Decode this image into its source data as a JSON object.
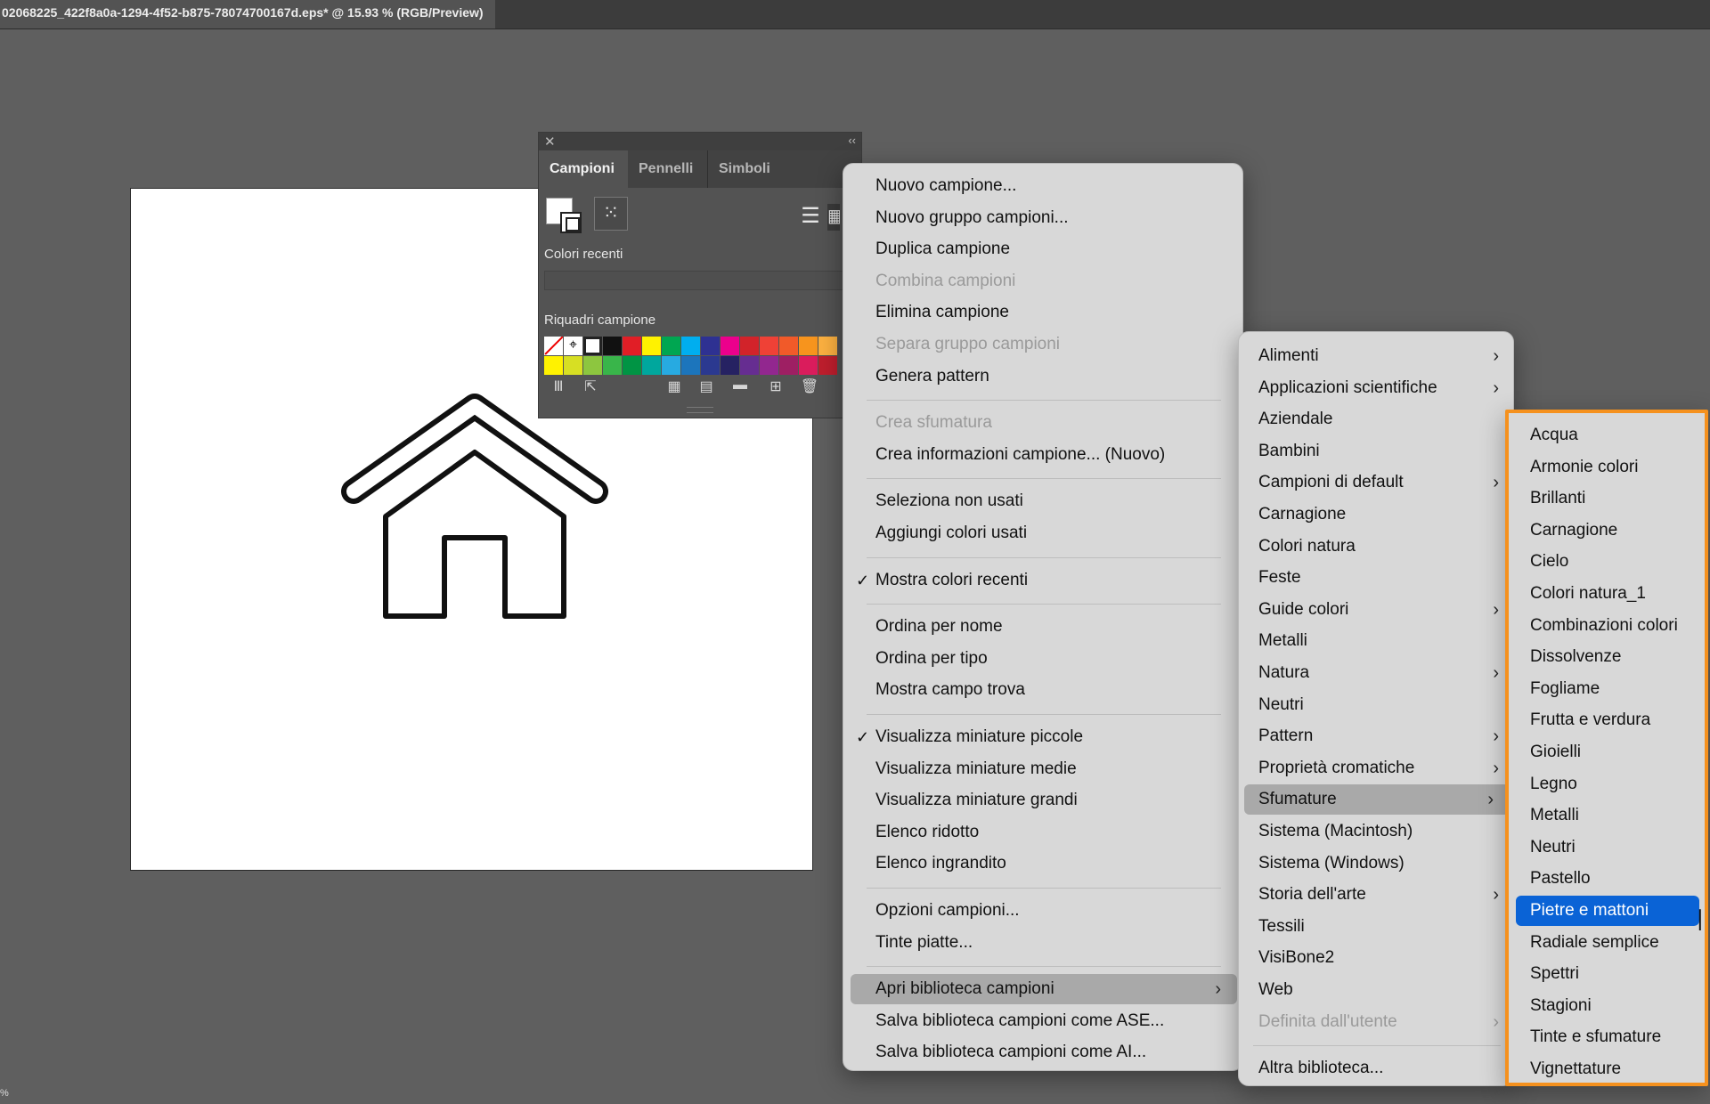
{
  "window": {
    "title": "02068225_422f8a0a-1294-4f52-b875-78074700167d.eps* @ 15.93 % (RGB/Preview)"
  },
  "panel": {
    "tabs": [
      "Campioni",
      "Pennelli",
      "Simboli"
    ],
    "recent_label": "Colori recenti",
    "swatches_label": "Riquadri campione",
    "swatch_colors_row1": [
      "none",
      "registration",
      "white",
      "#111111",
      "#e11e26",
      "#fff200",
      "#00a651",
      "#00aeef",
      "#2e3192",
      "#ec008c",
      "#d2232a",
      "#ef4136",
      "#f15a29",
      "#f7941d",
      "#fbb040"
    ],
    "swatch_colors_row2": [
      "#fff200",
      "#d7df23",
      "#8dc63f",
      "#39b54a",
      "#009444",
      "#00a79d",
      "#27aae1",
      "#1c75bc",
      "#2b3990",
      "#262262",
      "#662d91",
      "#92278f",
      "#9e1f63",
      "#da1c5c",
      "#be1e2d"
    ]
  },
  "menu1": {
    "items": [
      {
        "label": "Nuovo campione...",
        "disabled": false
      },
      {
        "label": "Nuovo gruppo campioni...",
        "disabled": false
      },
      {
        "label": "Duplica campione",
        "disabled": false
      },
      {
        "label": "Combina campioni",
        "disabled": true
      },
      {
        "label": "Elimina campione",
        "disabled": false
      },
      {
        "label": "Separa gruppo campioni",
        "disabled": true
      },
      {
        "label": "Genera pattern",
        "disabled": false
      },
      {
        "label": "Crea sfumatura",
        "disabled": true
      },
      {
        "label": "Crea informazioni campione... (Nuovo)",
        "disabled": false
      },
      {
        "label": "Seleziona non usati",
        "disabled": false
      },
      {
        "label": "Aggiungi colori usati",
        "disabled": false
      },
      {
        "label": "Mostra colori recenti",
        "checked": true
      },
      {
        "label": "Ordina per nome",
        "disabled": false
      },
      {
        "label": "Ordina per tipo",
        "disabled": false
      },
      {
        "label": "Mostra campo trova",
        "disabled": false
      },
      {
        "label": "Visualizza miniature piccole",
        "checked": true
      },
      {
        "label": "Visualizza miniature medie",
        "disabled": false
      },
      {
        "label": "Visualizza miniature grandi",
        "disabled": false
      },
      {
        "label": "Elenco ridotto",
        "disabled": false
      },
      {
        "label": "Elenco ingrandito",
        "disabled": false
      },
      {
        "label": "Opzioni campioni...",
        "disabled": false
      },
      {
        "label": "Tinte piatte...",
        "disabled": false
      },
      {
        "label": "Apri biblioteca campioni",
        "submenu": true,
        "highlighted": true
      },
      {
        "label": "Salva biblioteca campioni come ASE...",
        "disabled": false
      },
      {
        "label": "Salva biblioteca campioni come AI...",
        "disabled": false
      }
    ],
    "arrow_glyph": "›",
    "check_glyph": "✓"
  },
  "menu2": {
    "items": [
      {
        "label": "Alimenti",
        "submenu": true
      },
      {
        "label": "Applicazioni scientifiche",
        "submenu": true
      },
      {
        "label": "Aziendale"
      },
      {
        "label": "Bambini"
      },
      {
        "label": "Campioni di default",
        "submenu": true
      },
      {
        "label": "Carnagione"
      },
      {
        "label": "Colori natura"
      },
      {
        "label": "Feste"
      },
      {
        "label": "Guide colori",
        "submenu": true
      },
      {
        "label": "Metalli"
      },
      {
        "label": "Natura",
        "submenu": true
      },
      {
        "label": "Neutri"
      },
      {
        "label": "Pattern",
        "submenu": true
      },
      {
        "label": "Proprietà cromatiche",
        "submenu": true
      },
      {
        "label": "Sfumature",
        "submenu": true,
        "highlighted": true
      },
      {
        "label": "Sistema (Macintosh)"
      },
      {
        "label": "Sistema (Windows)"
      },
      {
        "label": "Storia dell'arte",
        "submenu": true
      },
      {
        "label": "Tessili"
      },
      {
        "label": "VisiBone2"
      },
      {
        "label": "Web"
      },
      {
        "label": "Definita dall'utente",
        "submenu": true,
        "disabled": true
      },
      {
        "label": "Altra biblioteca..."
      }
    ]
  },
  "menu3": {
    "items": [
      "Acqua",
      "Armonie colori",
      "Brillanti",
      "Carnagione",
      "Cielo",
      "Colori natura_1",
      "Combinazioni colori",
      "Dissolvenze",
      "Fogliame",
      "Frutta e verdura",
      "Gioielli",
      "Legno",
      "Metalli",
      "Neutri",
      "Pastello",
      "Pietre e mattoni",
      "Radiale semplice",
      "Spettri",
      "Stagioni",
      "Tinte e sfumature",
      "Vignettature"
    ],
    "selected_index": 15,
    "accent_color": "#f5911e",
    "selection_color": "#0a63d6"
  },
  "status": {
    "zoom_fragment": "%"
  }
}
